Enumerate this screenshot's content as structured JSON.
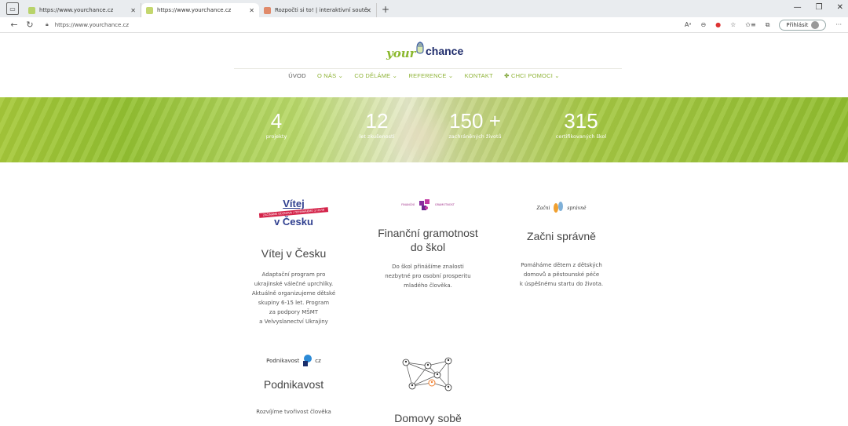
{
  "browser": {
    "tabs": [
      {
        "label": "https://www.yourchance.cz"
      },
      {
        "label": "https://www.yourchance.cz"
      },
      {
        "label": "Rozpočti si to! | interaktivní soutě"
      }
    ],
    "url": "https://www.yourchance.cz",
    "signin_label": "Přihlásit"
  },
  "logo": {
    "your": "your",
    "chance": "chance"
  },
  "nav": {
    "items": [
      "ÚVOD",
      "O NÁS",
      "CO DĚLÁME",
      "REFERENCE",
      "KONTAKT",
      "CHCI POMOCI"
    ]
  },
  "stats": [
    {
      "num": "4",
      "label": "projekty"
    },
    {
      "num": "12",
      "label": "let zkušeností"
    },
    {
      "num": "150 +",
      "label": "zachráněných životů"
    },
    {
      "num": "315",
      "label": "certifikovaných škol"
    }
  ],
  "cards": {
    "vitej": {
      "logo_line1": "Vítej",
      "logo_banner": "ZAČÍNÁME ODZNOVA / ПОЧИНАЄМО З НУЛЯ",
      "logo_line2": "v Česku",
      "title": "Vítej v Česku",
      "desc": [
        "Adaptační program pro",
        "ukrajinské válečné uprchlíky.",
        "Aktuálně organizujeme dětské",
        "skupiny 6-15 let. Program",
        "za podpory MŠMT",
        "a Velvyslanectví Ukrajiny"
      ]
    },
    "finance": {
      "logo_left": "FINANČNÍ",
      "logo_right": "GRAMOTNOST",
      "title_lines": [
        "Finanční gramotnost",
        "do škol"
      ],
      "desc": [
        "Do škol přinášíme znalosti",
        "nezbytné pro osobní prosperitu",
        "mladého člověka."
      ]
    },
    "zacni": {
      "logo_left": "Začni",
      "logo_right": "správně",
      "title": "Začni správně",
      "desc": [
        "Pomáháme dětem z dětských",
        "domovů a pěstounské péče",
        "k úspěšnému startu do života."
      ]
    },
    "podnikavost": {
      "logo_left": "Podnikavost",
      "logo_right": "cz",
      "title": "Podnikavost",
      "desc": [
        "Rozvíjíme tvořivost člověka"
      ]
    },
    "domovy": {
      "title": "Domovy sobě"
    }
  }
}
